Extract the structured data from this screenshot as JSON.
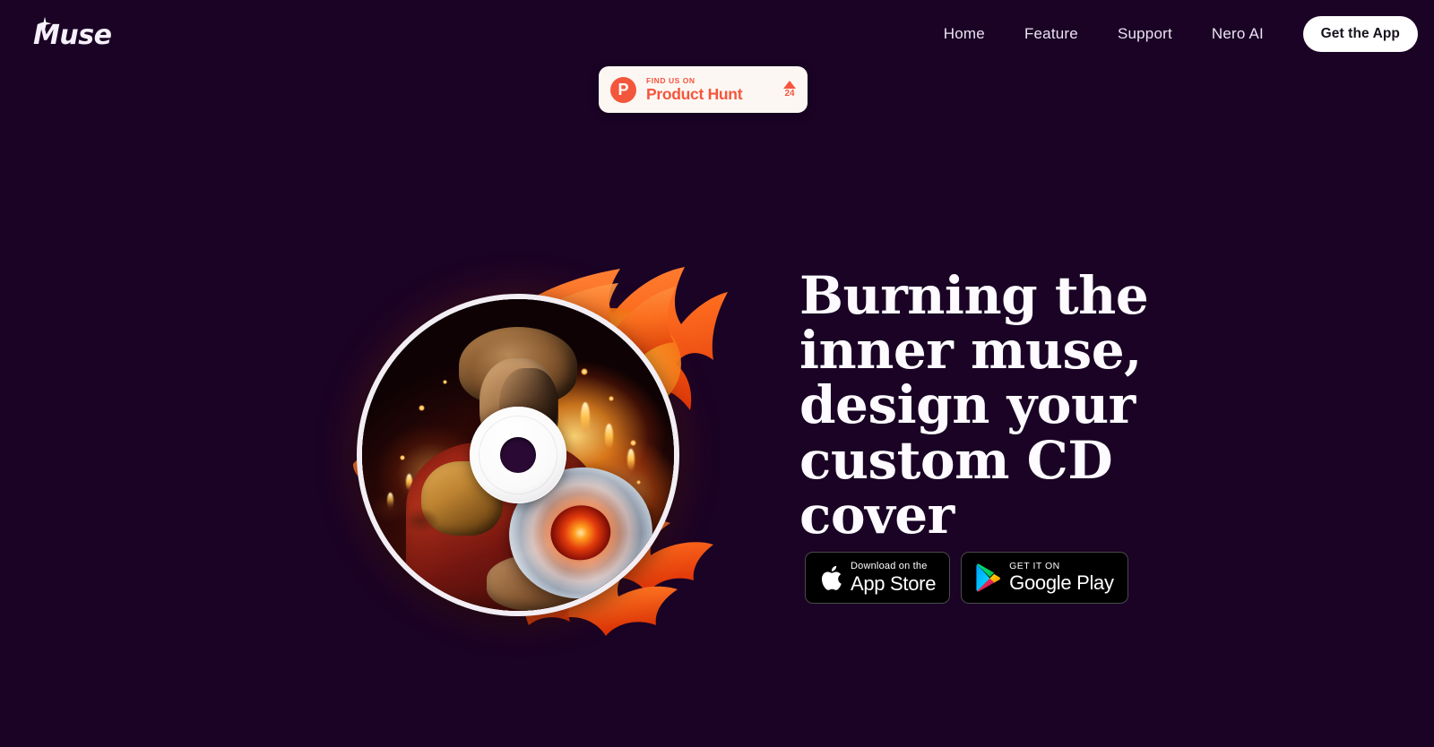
{
  "theme": {
    "background": "#1a0325",
    "accent_coral": "#f4563c",
    "text_light": "#ece3f3",
    "headline_color": "#fdfbff",
    "badge_bg": "#fdf7f4",
    "button_bg": "#ffffff",
    "store_bg": "#000000"
  },
  "navbar": {
    "logo_text": "Muse",
    "logo_icon": "sparkle-icon",
    "links": [
      {
        "label": "Home"
      },
      {
        "label": "Feature"
      },
      {
        "label": "Support"
      },
      {
        "label": "Nero AI"
      }
    ],
    "cta_label": "Get the App"
  },
  "product_hunt": {
    "icon": "product-hunt-icon",
    "logo_letter": "P",
    "kicker": "FIND US ON",
    "name": "Product Hunt",
    "upvote_icon": "upvote-triangle-icon",
    "upvote_count": "24"
  },
  "hero": {
    "headline": "Burning the inner muse, design your custom CD cover",
    "artwork": {
      "name": "cd-cover-artwork",
      "description": "Flaming CD disc with AI-generated Roman emperor holding a glowing vinyl record"
    },
    "stores": [
      {
        "icon": "apple-icon",
        "small_label": "Download on the",
        "big_label": "App Store",
        "uppercase_small": false
      },
      {
        "icon": "google-play-icon",
        "small_label": "GET IT ON",
        "big_label": "Google Play",
        "uppercase_small": true
      }
    ]
  }
}
